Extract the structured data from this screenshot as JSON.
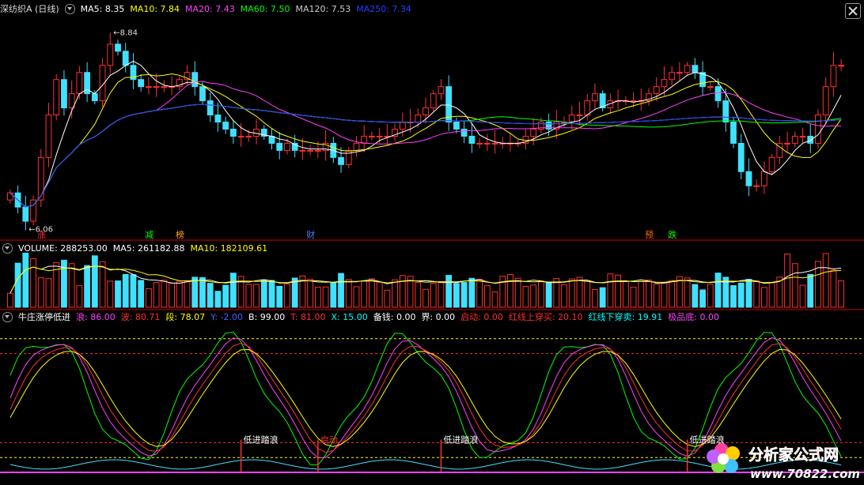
{
  "main": {
    "title": "深纺织A (日线)",
    "ma": [
      {
        "label": "MA5: 8.35",
        "color": "#ffffff"
      },
      {
        "label": "MA10: 7.84",
        "color": "#ffff00"
      },
      {
        "label": "MA20: 7.43",
        "color": "#ff40ff"
      },
      {
        "label": "MA60: 7.50",
        "color": "#00ff00"
      },
      {
        "label": "MA120: 7.53",
        "color": "#cccccc"
      },
      {
        "label": "MA250: 7.34",
        "color": "#2040ff"
      }
    ],
    "high_label": "8.84",
    "low_label": "6.06",
    "markers": [
      {
        "text": "涨",
        "color": "#ff3030"
      },
      {
        "text": "减",
        "color": "#00ff00"
      },
      {
        "text": "榜",
        "color": "#ffaa00"
      },
      {
        "text": "财",
        "color": "#4080ff"
      },
      {
        "text": "预",
        "color": "#ff6600"
      },
      {
        "text": "跌",
        "color": "#00ff00"
      }
    ]
  },
  "volume": {
    "labels": [
      {
        "label": "VOLUME: 288253.00",
        "color": "#ffffff"
      },
      {
        "label": "MA5: 261182.88",
        "color": "#ffffff"
      },
      {
        "label": "MA10: 182109.61",
        "color": "#ffff00"
      }
    ]
  },
  "indicator": {
    "labels": [
      {
        "label": "牛庄涨停低进",
        "color": "#ffffff"
      },
      {
        "label": "浪: 86.00",
        "color": "#ff40ff"
      },
      {
        "label": "波: 80.71",
        "color": "#ff3030"
      },
      {
        "label": "段: 78.07",
        "color": "#ffff00"
      },
      {
        "label": "Y: -2.00",
        "color": "#4060ff"
      },
      {
        "label": "B: 99.00",
        "color": "#ffffff"
      },
      {
        "label": "T: 81.00",
        "color": "#ff3030"
      },
      {
        "label": "X: 15.00",
        "color": "#00ffff"
      },
      {
        "label": "备钱: 0.00",
        "color": "#ffffff"
      },
      {
        "label": "界: 0.00",
        "color": "#ffffff"
      },
      {
        "label": "启动: 0.00",
        "color": "#ff3030"
      },
      {
        "label": "红线上穿买: 20.10",
        "color": "#ff3030"
      },
      {
        "label": "红线下穿卖: 19.91",
        "color": "#00ffff"
      },
      {
        "label": "极品底: 0.00",
        "color": "#ff40ff"
      }
    ],
    "annotations": [
      "低进踏浪",
      "启动",
      "低进踏浪",
      "低进踏浪"
    ]
  },
  "logo": {
    "name": "分析家公式网",
    "url": "www.70822.com"
  },
  "chart_data": [
    {
      "type": "candlestick",
      "title": "深纺织A (日线)",
      "close": [
        6.5,
        6.3,
        6.1,
        6.4,
        7.0,
        7.6,
        8.1,
        7.7,
        7.9,
        8.2,
        7.9,
        7.8,
        8.3,
        8.6,
        8.5,
        8.3,
        8.1,
        8.0,
        8.0,
        8.0,
        8.0,
        8.0,
        8.1,
        8.2,
        8.0,
        7.8,
        7.6,
        7.5,
        7.4,
        7.3,
        7.3,
        7.3,
        7.4,
        7.3,
        7.2,
        7.1,
        7.2,
        7.1,
        7.1,
        7.1,
        7.1,
        7.2,
        7.0,
        6.9,
        7.1,
        7.2,
        7.3,
        7.3,
        7.3,
        7.3,
        7.4,
        7.5,
        7.5,
        7.6,
        7.7,
        7.9,
        8.0,
        7.5,
        7.4,
        7.3,
        7.2,
        7.2,
        7.2,
        7.2,
        7.2,
        7.2,
        7.2,
        7.3,
        7.4,
        7.5,
        7.4,
        7.5,
        7.5,
        7.6,
        7.6,
        7.8,
        7.9,
        7.7,
        7.8,
        7.8,
        7.8,
        7.8,
        7.8,
        7.9,
        8.0,
        8.1,
        8.2,
        8.2,
        8.3,
        8.2,
        8.0,
        8.0,
        7.8,
        7.5,
        7.2,
        6.8,
        6.6,
        6.6,
        6.8,
        7.0,
        7.2,
        7.2,
        7.3,
        7.3,
        7.2,
        7.6,
        8.0,
        8.3,
        8.3
      ],
      "high_annotation": 8.84,
      "low_annotation": 6.06,
      "series": [
        {
          "name": "MA5",
          "value": 8.35
        },
        {
          "name": "MA10",
          "value": 7.84
        },
        {
          "name": "MA20",
          "value": 7.43
        },
        {
          "name": "MA60",
          "value": 7.5
        },
        {
          "name": "MA120",
          "value": 7.53
        },
        {
          "name": "MA250",
          "value": 7.34
        }
      ]
    },
    {
      "type": "bar",
      "title": "VOLUME",
      "series": [
        {
          "name": "VOLUME",
          "value": 288253.0
        },
        {
          "name": "MA5",
          "value": 261182.88
        },
        {
          "name": "MA10",
          "value": 182109.61
        }
      ]
    },
    {
      "type": "line",
      "title": "牛庄涨停低进",
      "series": [
        {
          "name": "浪",
          "value": 86.0
        },
        {
          "name": "波",
          "value": 80.71
        },
        {
          "name": "段",
          "value": 78.07
        },
        {
          "name": "Y",
          "value": -2.0
        },
        {
          "name": "B",
          "value": 99.0
        },
        {
          "name": "T",
          "value": 81.0
        },
        {
          "name": "X",
          "value": 15.0
        }
      ]
    }
  ]
}
